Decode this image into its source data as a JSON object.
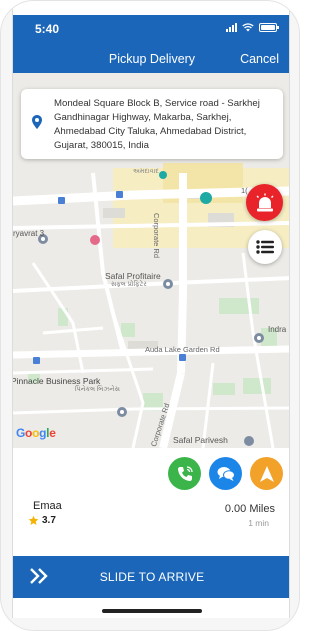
{
  "status_bar": {
    "time": "5:40"
  },
  "nav": {
    "title": "Pickup Delivery",
    "cancel_label": "Cancel"
  },
  "address": {
    "lines": [
      "Mondeal Square Block B, Service road - Sarkhej",
      "Gandhinagar Highway, Makarba, Sarkhej,",
      "Ahmedabad City Taluka, Ahmedabad District,",
      "Gujarat, 380015, India"
    ]
  },
  "map": {
    "labels": {
      "vrajvrat": "ryavrat 3",
      "safal_profitaire": "Safal Profitaire",
      "safal_profitaire_gu": "સફલ પ્રોફિટેર",
      "pinnacle": "Pinnacle Business Park",
      "pinnacle_gu": "પિનેકલ બિઝનેસ",
      "safal_parivesh": "Safal Parivesh",
      "indra": "Indra",
      "auda_road": "Auda Lake Garden Rd",
      "corporate_road_1": "Corporate Rd",
      "corporate_road_2": "Corporate Rd",
      "top_gu": "અમદાવાદ",
      "num_label": "1("
    },
    "google_letters": [
      "G",
      "o",
      "o",
      "g",
      "l",
      "e"
    ],
    "google_colors": [
      "#4285F4",
      "#EA4335",
      "#FBBC05",
      "#4285F4",
      "#34A853",
      "#EA4335"
    ]
  },
  "driver": {
    "name": "Emaa",
    "rating": "3.7",
    "distance": "0.00 Miles",
    "duration": "1 min"
  },
  "slide": {
    "label": "SLIDE TO ARRIVE"
  },
  "colors": {
    "primary": "#1b66b9",
    "sos": "#e8232a",
    "call": "#3bb54a",
    "chat": "#1c86e8",
    "navigate": "#f2a129",
    "star": "#f5b301"
  },
  "icons": {
    "pin": "location-pin-icon",
    "sos": "siren-icon",
    "list": "list-icon",
    "call": "phone-icon",
    "chat": "chat-bubbles-icon",
    "navigate": "navigation-arrow-icon",
    "star": "star-icon",
    "slide": "double-chevron-right-icon"
  }
}
